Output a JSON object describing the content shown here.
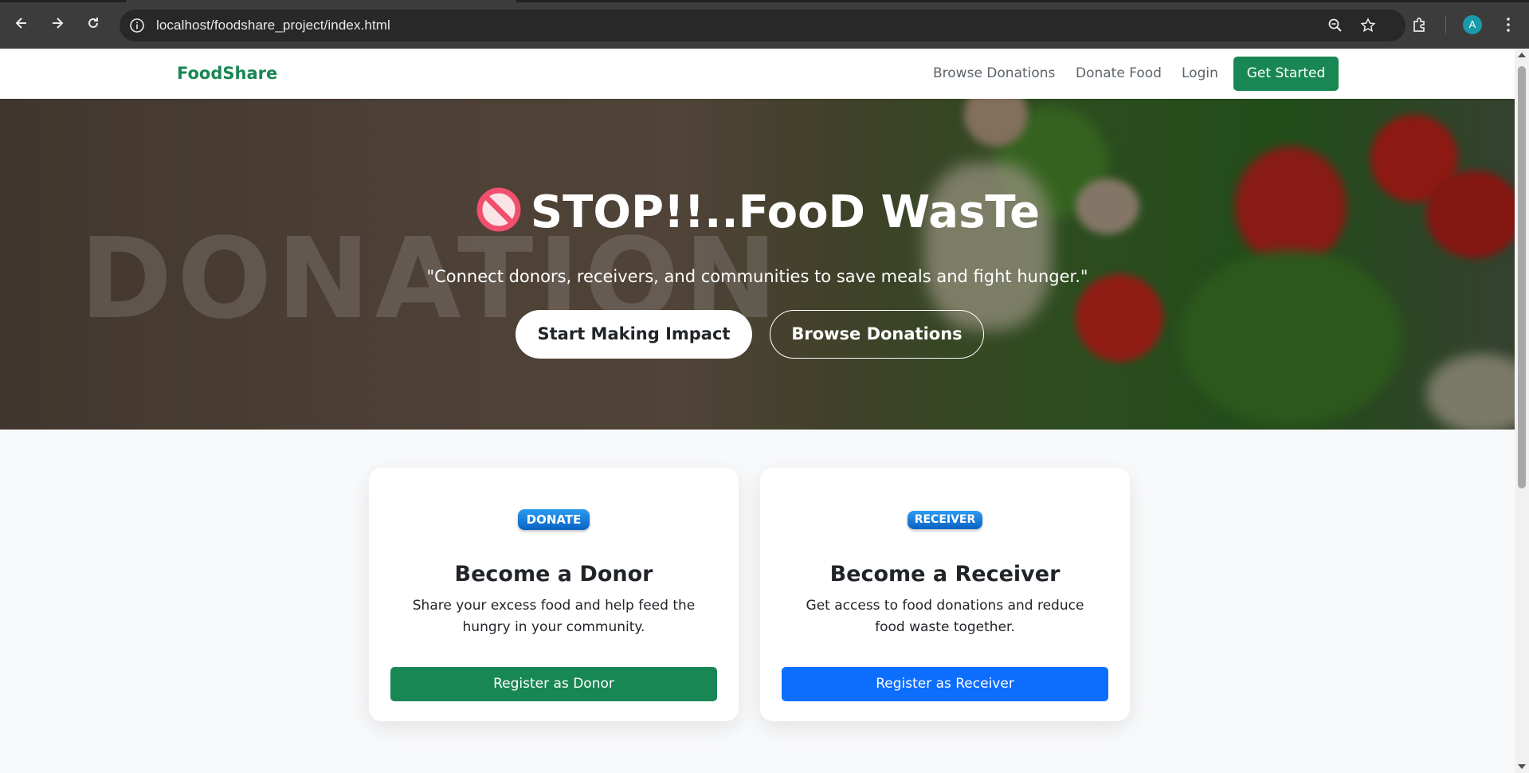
{
  "browser": {
    "url": "localhost/foodshare_project/index.html",
    "avatar_letter": "A",
    "icons": [
      "back-icon",
      "forward-icon",
      "reload-icon",
      "site-info-icon",
      "zoom-icon",
      "bookmark-star-icon",
      "extensions-icon",
      "profile-avatar",
      "menu-icon"
    ]
  },
  "nav": {
    "brand": "FoodShare",
    "links": [
      "Browse Donations",
      "Donate Food",
      "Login"
    ],
    "cta": "Get Started"
  },
  "hero": {
    "icon": "prohibited-icon",
    "headline": "STOP!!..FooD WasTe",
    "tagline": "\"Connect donors, receivers, and communities to save meals and fight hunger.\"",
    "watermark": "DONATION",
    "primary_button": "Start Making Impact",
    "secondary_button": "Browse Donations"
  },
  "cards": [
    {
      "badge": "DONATE",
      "title": "Become a Donor",
      "description": "Share your excess food and help feed the hungry in your community.",
      "button": "Register as Donor",
      "button_color": "#198754"
    },
    {
      "badge": "RECEIVER",
      "title": "Become a Receiver",
      "description": "Get access to food donations and reduce food waste together.",
      "button": "Register as Receiver",
      "button_color": "#0d6efd"
    }
  ],
  "colors": {
    "brand": "#198754",
    "primary": "#0d6efd",
    "page_bg": "#f8f9fa"
  }
}
